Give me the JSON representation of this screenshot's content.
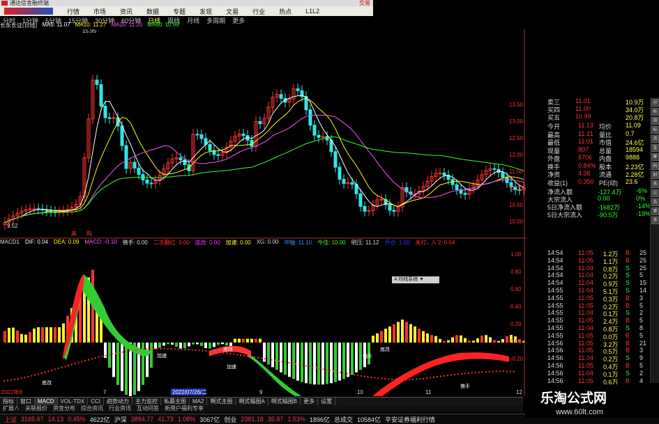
{
  "app": {
    "title": "通达信金融终端",
    "trade_label": "交易"
  },
  "menu": [
    "行情",
    "市场",
    "资讯",
    "数据",
    "专题",
    "发现",
    "文易",
    "行业",
    "热点",
    "L1L2"
  ],
  "periods": {
    "items": [
      "分时",
      "1分钟",
      "5分钟",
      "15分钟",
      "30分钟",
      "60分钟",
      "日线",
      "周线",
      "月线",
      "多周期",
      "更多"
    ],
    "active": "日线"
  },
  "stock": {
    "name": "长永长证(日线)",
    "ma5": "MA5: 11.07",
    "ma10": "MA10: 11.27",
    "ma20": "MA20: 11.20",
    "ma60": "MA60: 10.99",
    "high_mark": "15.95",
    "low_mark": "9.52",
    "markers": [
      "高",
      "购"
    ]
  },
  "price_axis": [
    "13.50",
    "13.00",
    "12.50",
    "12.00",
    "11.50",
    "11.00",
    "10.50",
    "10.00"
  ],
  "indicator_header": {
    "items": [
      "MACD1",
      "DIF: 0.04",
      "DEA: 0.09",
      "MACD: -0.10",
      "佛手: 0.00",
      "二次翻红: 0.00",
      "底改: 0.00",
      "加速: 0.00",
      "XG: 0.00",
      "中轴: 11.10",
      "今佳: 10.00",
      "明压: 11.12",
      "开仓: 1.00",
      "关灯↓ 入 2: 0.04",
      "77: -0.08"
    ]
  },
  "indicator_axis": [
    "1.00",
    "0.80",
    "0.60",
    "0.40",
    "0.20",
    "0.00",
    "-0.20"
  ],
  "indicator_labels": {
    "popup": "A 均线系统 ▼",
    "tags": [
      "加速",
      "加速",
      "底改",
      "底改",
      "佛手",
      "佛手",
      "底改"
    ],
    "bottom_date": "2022/07/26/二",
    "bottom_year": "2022年8",
    "ticks": [
      "7",
      "9",
      "10",
      "11",
      "12"
    ]
  },
  "order_book": {
    "rows": [
      {
        "label": "卖三",
        "price": "11.01",
        "vol": "10.9万"
      },
      {
        "label": "买四",
        "price": "11.00",
        "vol": "34.0万"
      },
      {
        "label": "买五",
        "price": "10.99",
        "vol": "20.8万"
      }
    ]
  },
  "quote_fields": [
    {
      "l": "今开",
      "v": "11.13",
      "l2": "均价",
      "v2": "11.09"
    },
    {
      "l": "最高",
      "v": "11.21",
      "l2": "量比",
      "v2": "0.7"
    },
    {
      "l": "最低",
      "v": "11.01",
      "l2": "市值",
      "v2": "24.6亿"
    },
    {
      "l": "现量",
      "v": "807",
      "l2": "总量",
      "v2": "18594"
    },
    {
      "l": "外盘",
      "v": "8706",
      "l2": "内盘",
      "v2": "9888"
    },
    {
      "l": "换手",
      "v": "0.84%",
      "l2": "股本",
      "v2": "2.23亿"
    },
    {
      "l": "净资",
      "v": "4.38",
      "l2": "流通",
      "v2": "2.28亿"
    },
    {
      "l": "收益(1)",
      "v": "0.350",
      "l2": "PE(动)",
      "v2": "23.6"
    }
  ],
  "flows": [
    {
      "l": "净流入额",
      "v": "-127.4万",
      "p": "-6%"
    },
    {
      "l": "大宗流入",
      "v": "0.00",
      "p": "0%"
    },
    {
      "l": "5日净流入额",
      "v": "-1682万",
      "p": "-14%"
    },
    {
      "l": "5日大宗流入",
      "v": "-90.5万",
      "p": "-19%"
    }
  ],
  "ticks_list": [
    {
      "t": "14:54",
      "p": "11.05",
      "v": "1.2万",
      "s": "B",
      "n": "25"
    },
    {
      "t": "14:54",
      "p": "11.05",
      "v": "1.1万",
      "s": "B",
      "n": "25"
    },
    {
      "t": "14:54",
      "p": "11.04",
      "v": "0.8万",
      "s": "S",
      "n": "25"
    },
    {
      "t": "14:54",
      "p": "11.04",
      "v": "0.2万",
      "s": "S",
      "n": "5"
    },
    {
      "t": "14:54",
      "p": "11.04",
      "v": "0.9万",
      "s": "S",
      "n": "15"
    },
    {
      "t": "14:55",
      "p": "11.04",
      "v": "5.1万",
      "s": "S",
      "n": "14"
    },
    {
      "t": "14:55",
      "p": "11.05",
      "v": "0.3万",
      "s": "B",
      "n": "3"
    },
    {
      "t": "14:55",
      "p": "11.05",
      "v": "0.2万",
      "s": "B",
      "n": "5"
    },
    {
      "t": "14:55",
      "p": "11.04",
      "v": "0.1万",
      "s": "S",
      "n": "2"
    },
    {
      "t": "14:55",
      "p": "11.05",
      "v": "2.4万",
      "s": "B",
      "n": "5"
    },
    {
      "t": "14:55",
      "p": "11.04",
      "v": "0.8万",
      "s": "S",
      "n": "8"
    },
    {
      "t": "14:55",
      "p": "11.05",
      "v": "0.0万",
      "s": "B",
      "n": "5"
    },
    {
      "t": "14:56",
      "p": "11.05",
      "v": "3.2万",
      "s": "B",
      "n": "21"
    },
    {
      "t": "14:56",
      "p": "11.05",
      "v": "0.5万",
      "s": "B",
      "n": "3"
    },
    {
      "t": "14:56",
      "p": "11.04",
      "v": "0.2万",
      "s": "S",
      "n": "9"
    },
    {
      "t": "14:56",
      "p": "11.05",
      "v": "0.4万",
      "s": "B",
      "n": "5"
    },
    {
      "t": "14:56",
      "p": "11.04",
      "v": "0.1万",
      "s": "S",
      "n": "2"
    },
    {
      "t": "14:56",
      "p": "11.05",
      "v": "0.6万",
      "s": "B",
      "n": "4"
    }
  ],
  "scroll_icons": [
    "分",
    "析",
    "指",
    "标",
    "资",
    "金",
    "筹",
    "码",
    "财",
    "务",
    "公",
    "告",
    "更",
    "多"
  ],
  "bottom_tabs": [
    "指标",
    "窗口",
    "MACD",
    "VOL-TDX",
    "CCI",
    "趋势动力",
    "主力监控",
    "私募主图",
    "MA2",
    "啊式主图",
    "啊式幅图A",
    "啊式幅图B",
    "更多",
    "设置"
  ],
  "bottom_tabs_active": "MACD",
  "bottom_tabs2": [
    "扩展∧",
    "关联报价",
    "资金分布",
    "综合资讯",
    "行业资讯",
    "互动问答",
    "新用户福利专享"
  ],
  "status_bar": {
    "sh_label": "上证",
    "sh": "3165.47",
    "sh_chg": "14.13",
    "sh_pct": "0.45%",
    "sh_amt": "4622亿",
    "sz_label": "沪深",
    "sz": "3894.77",
    "sz_chg": "41.73",
    "sz_pct": "1.08%",
    "sz_amt": "3067亿",
    "cy_label": "创业",
    "cy": "2381.18",
    "cy_chg": "35.87",
    "cy_pct": "1.53%",
    "cy_amt": "1896亿",
    "total_label": "总成交",
    "total": "10584亿",
    "broker": "平安证券福利行情"
  },
  "watermark": {
    "big": "乐淘公式网",
    "small": "www.60lt.com"
  },
  "colors": {
    "up": "#ff3333",
    "down": "#33e5e5",
    "macd_up": "#ffee33",
    "macd_down": "#33cc33"
  }
}
